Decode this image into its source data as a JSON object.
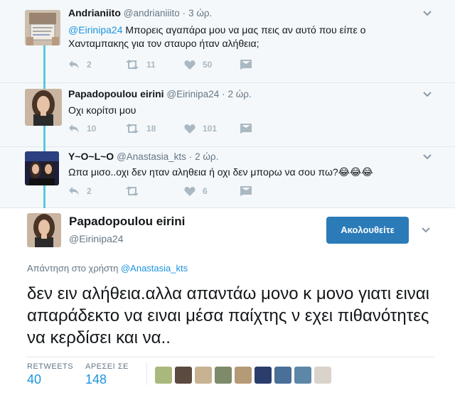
{
  "tweets": [
    {
      "name": "Andrianiito",
      "handle": "@andrianiiito",
      "time": "3 ώρ.",
      "mention": "@Eirinipa24",
      "text_line1": " Μπορεις αγαπάρα μου να μας πεις αν αυτό που είπε ο",
      "text_line2": "Χανταμπακης για τον σταυρο ήταν αλήθεια;",
      "replies": "2",
      "retweets": "11",
      "likes": "50"
    },
    {
      "name": "Papadopoulou eirini",
      "handle": "@Eirinipa24",
      "time": "2 ώρ.",
      "text": "Οχι κορίτσι μου",
      "replies": "10",
      "retweets": "18",
      "likes": "101"
    },
    {
      "name": "Y~O~L~O",
      "handle": "@Anastasia_kts",
      "time": "2 ώρ.",
      "text": "Ωπα μισο..οχι δεν ηταν αληθεια ή οχι δεν μπορω να σου πω?😂😂😂",
      "replies": "2",
      "retweets": "",
      "likes": "6"
    }
  ],
  "main_tweet": {
    "name": "Papadopoulou eirini",
    "handle": "@Eirinipa24",
    "follow_label": "Ακολουθείτε",
    "replying_prefix": "Απάντηση στο χρήστη ",
    "replying_to": "@Anastasia_kts",
    "text": "δεν ειν αλήθεια.αλλα απαντάω μονο κ μονο γιατι ειναι απαράδεκτο να ειναι μέσα παίχτης ν εχει πιθανότητες να κερδίσει και να..",
    "retweets_label": "RETWEETS",
    "retweets_count": "40",
    "likes_label": "ΑΡΕΣΕΙ ΣΕ",
    "likes_count": "148"
  },
  "colors": {
    "accent": "#1b95e0",
    "follow_button": "#2b7bb9",
    "thread_line": "#5ac8e0",
    "muted": "#657786",
    "icon": "#aab8c2",
    "reply_bg": "#f5f8fa"
  },
  "icons": [
    "reply-icon",
    "retweet-icon",
    "like-icon",
    "direct-message-icon",
    "chevron-down-icon"
  ]
}
